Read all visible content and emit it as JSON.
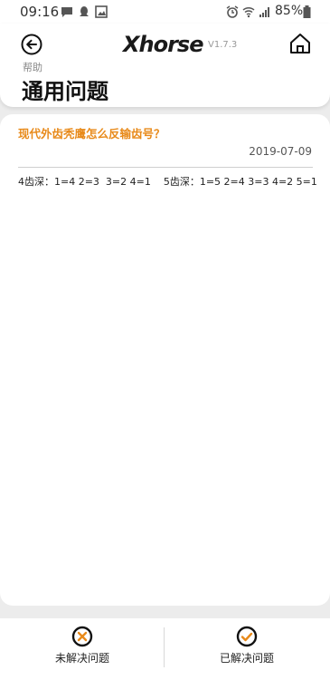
{
  "status_bar": {
    "time": "09:16",
    "battery_percent": "85%",
    "icons": [
      "message-icon",
      "qq-icon",
      "gallery-icon",
      "alarm-icon",
      "wifi-icon",
      "signal-icon",
      "battery-icon"
    ]
  },
  "header": {
    "logo": "Xhorse",
    "version": "V1.7.3",
    "breadcrumb": "帮助",
    "title": "通用问题",
    "icons": {
      "back": "back-arrow-icon",
      "home": "home-icon"
    }
  },
  "question": {
    "title": "现代外齿秃鹰怎么反输齿号？",
    "date": "2019-07-09",
    "answer": "4齿深：1=4 2=3  3=2 4=1    5齿深：1=5 2=4 3=3 4=2 5=1"
  },
  "actions": {
    "unresolved_label": "未解决问题",
    "resolved_label": "已解决问题"
  },
  "colors": {
    "accent_orange": "#e88a1a",
    "background": "#ececec",
    "card": "#ffffff"
  }
}
